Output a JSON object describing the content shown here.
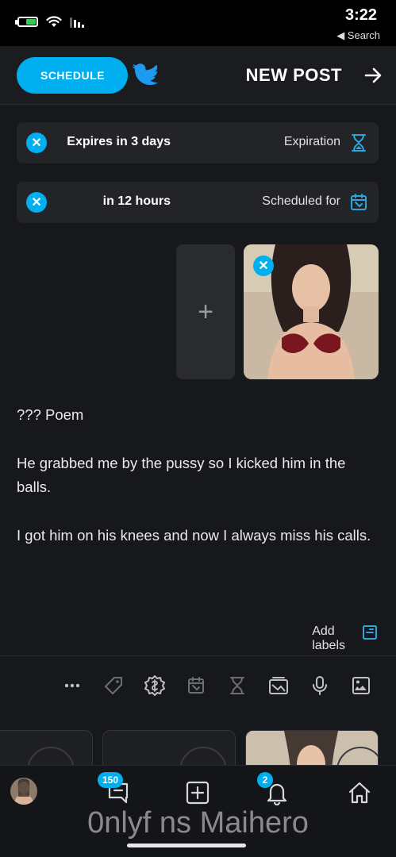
{
  "status_bar": {
    "time": "3:22",
    "back_app": "◀ Search",
    "battery_level": 0.6,
    "battery_color": "#34c759"
  },
  "header": {
    "title": "NEW POST",
    "back_icon": "arrow-left-icon",
    "twitter_icon": "twitter-bird-icon",
    "schedule_label": "SCHEDULE",
    "accent": "#00aff0"
  },
  "settings": [
    {
      "icon": "hourglass-icon",
      "label": "Expiration",
      "value": "Expires in 3 days"
    },
    {
      "icon": "calendar-icon",
      "label": "Scheduled for",
      "value": "in 12 hours"
    }
  ],
  "media": {
    "add_label": "+"
  },
  "post": {
    "paragraphs": [
      "??? Poem",
      "He grabbed me by the pussy so I kicked him in the balls.",
      "I got him on his knees and now I always miss his calls."
    ]
  },
  "labels": {
    "text": "Add labels",
    "icon": "label-icon"
  },
  "toolbar": {
    "tools": [
      "image-icon",
      "microphone-icon",
      "gallery-icon",
      "hourglass-icon",
      "calendar-icon",
      "price-icon",
      "tag-icon",
      "more-icon"
    ]
  },
  "bottom_nav": {
    "items": [
      "home-icon",
      "notifications-icon",
      "add-icon",
      "messages-icon",
      "avatar"
    ],
    "notifications_badge": "2",
    "messages_badge": "150"
  },
  "watermark": "0nlyf ns Maihero"
}
